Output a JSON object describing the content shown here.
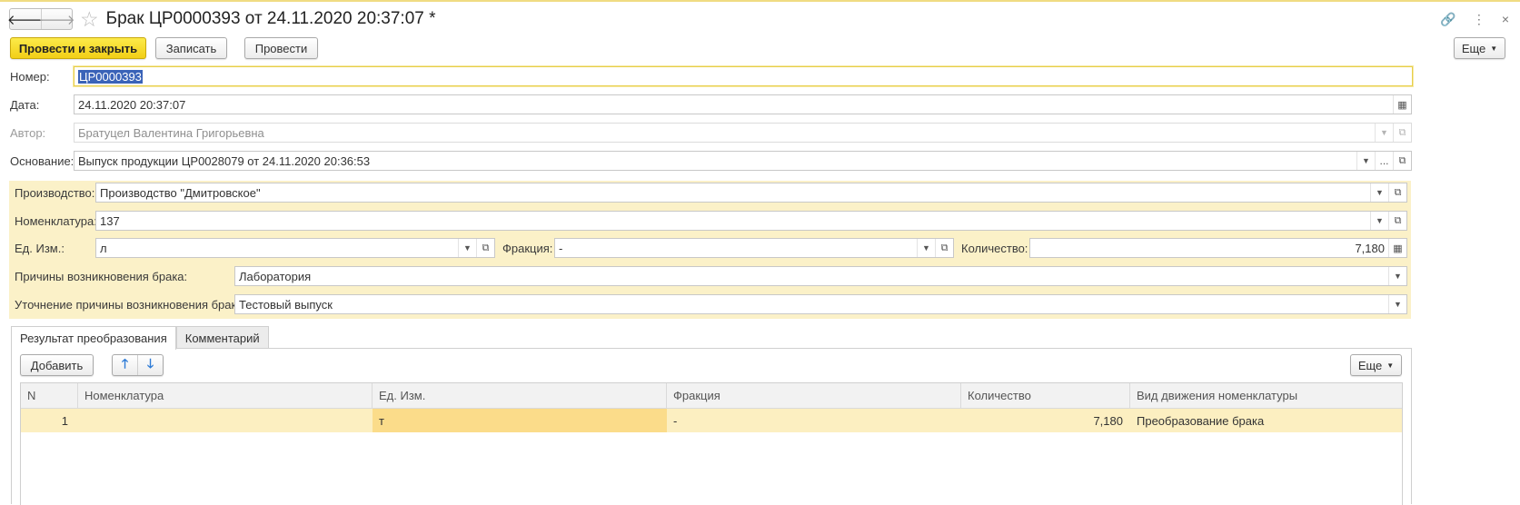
{
  "window": {
    "title": "Брак ЦР0000393 от 24.11.2020 20:37:07 *",
    "icons": {
      "back": "arrow-left-icon",
      "forward": "arrow-right-icon",
      "favorite": "star-icon",
      "link": "link-icon",
      "menu": "more-vertical-icon",
      "close": "close-icon"
    },
    "glyphs": {
      "back": "🡐",
      "forward": "🡒",
      "star": "☆",
      "link": "🔗",
      "menu": "⋮",
      "close": "×"
    }
  },
  "toolbar": {
    "post_close": "Провести и закрыть",
    "save": "Записать",
    "post": "Провести",
    "more": "Еще"
  },
  "fields": {
    "number": {
      "label": "Номер:",
      "value": "ЦР0000393"
    },
    "date": {
      "label": "Дата:",
      "value": "24.11.2020 20:37:07"
    },
    "author": {
      "label": "Автор:",
      "value": "Братуцел Валентина Григорьевна"
    },
    "basis": {
      "label": "Основание:",
      "value": "Выпуск продукции ЦР0028079 от 24.11.2020 20:36:53",
      "ellipsis": "..."
    },
    "production": {
      "label": "Производство:",
      "value": "Производство \"Дмитровское\""
    },
    "nomenclature": {
      "label": "Номенклатура:",
      "value": "137"
    },
    "unit": {
      "label": "Ед. Изм.:",
      "value": "л"
    },
    "fraction": {
      "label": "Фракция:",
      "value": "-"
    },
    "quantity": {
      "label": "Количество:",
      "value": "7,180"
    },
    "defect_reason": {
      "label": "Причины возникновения брака:",
      "value": "Лаборатория"
    },
    "defect_reason_detail": {
      "label": "Уточнение причины возникновения брака:",
      "value": "Тестовый выпуск"
    }
  },
  "tabs": [
    {
      "label": "Результат преобразования",
      "active": true
    },
    {
      "label": "Комментарий",
      "active": false
    }
  ],
  "table_toolbar": {
    "add": "Добавить",
    "up_glyph": "🡑",
    "down_glyph": "🡓",
    "more": "Еще"
  },
  "table": {
    "columns": [
      "N",
      "Номенклатура",
      "Ед. Изм.",
      "Фракция",
      "Количество",
      "Вид движения номенклатуры"
    ],
    "rows": [
      [
        "1",
        "",
        "т",
        "-",
        "7,180",
        "Преобразование брака"
      ]
    ]
  },
  "colors": {
    "accent_yellow": "#f2cf16",
    "group_bg": "#fbf1c8",
    "selection": "#3a63b8",
    "row_highlight": "#fcefc1"
  }
}
